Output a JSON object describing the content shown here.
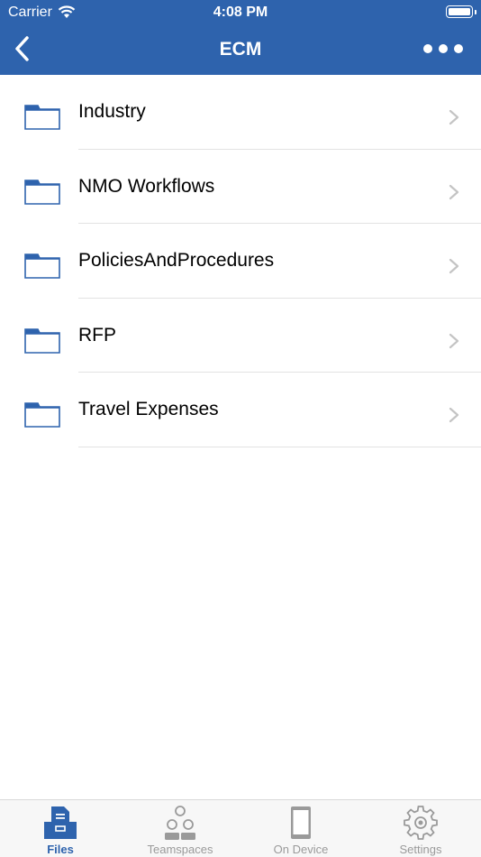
{
  "status_bar": {
    "carrier": "Carrier",
    "time": "4:08 PM"
  },
  "nav": {
    "title": "ECM"
  },
  "folders": [
    {
      "name": "Industry"
    },
    {
      "name": "NMO Workflows"
    },
    {
      "name": "PoliciesAndProcedures"
    },
    {
      "name": "RFP"
    },
    {
      "name": "Travel Expenses"
    }
  ],
  "tabs": [
    {
      "label": "Files",
      "icon": "files-icon",
      "active": true
    },
    {
      "label": "Teamspaces",
      "icon": "teamspaces-icon",
      "active": false
    },
    {
      "label": "On Device",
      "icon": "device-icon",
      "active": false
    },
    {
      "label": "Settings",
      "icon": "gear-icon",
      "active": false
    }
  ],
  "colors": {
    "accent": "#2e63ad",
    "inactive": "#9a9a9a",
    "separator": "#e2e2e2"
  }
}
